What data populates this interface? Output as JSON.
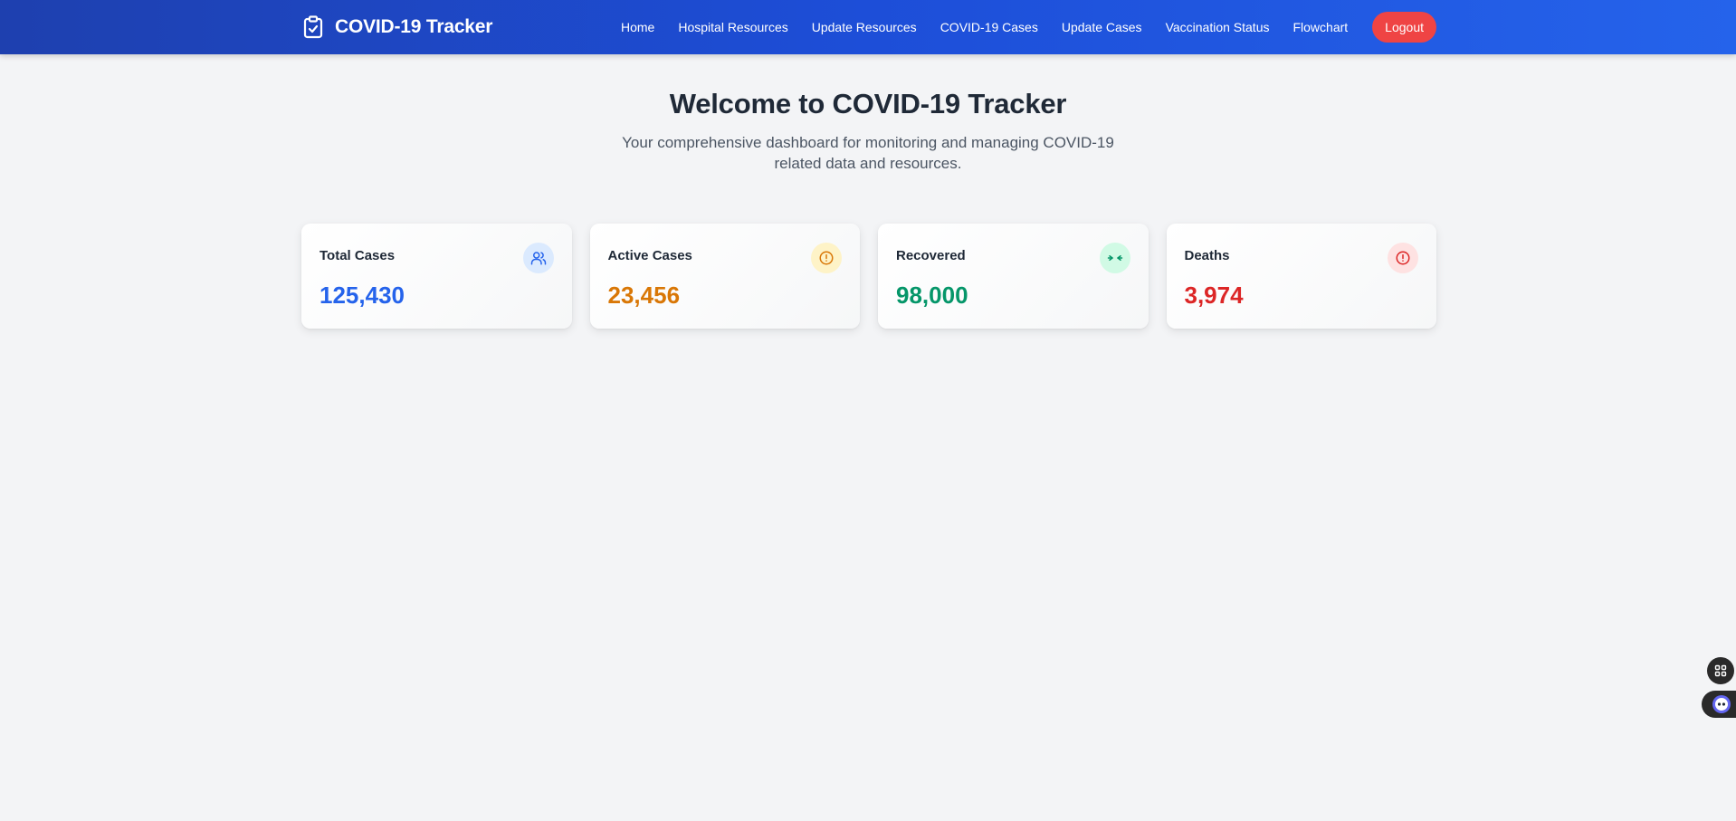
{
  "app": {
    "title": "COVID-19 Tracker",
    "brand_icon": "clipboard-check-icon"
  },
  "nav": {
    "links": [
      {
        "label": "Home"
      },
      {
        "label": "Hospital Resources"
      },
      {
        "label": "Update Resources"
      },
      {
        "label": "COVID-19 Cases"
      },
      {
        "label": "Update Cases"
      },
      {
        "label": "Vaccination Status"
      },
      {
        "label": "Flowchart"
      }
    ],
    "logout_label": "Logout"
  },
  "hero": {
    "title": "Welcome to COVID-19 Tracker",
    "subtitle": "Your comprehensive dashboard for monitoring and managing COVID-19 related data and resources."
  },
  "stats": [
    {
      "label": "Total Cases",
      "value": "125,430",
      "icon": "users-icon",
      "color": "#2563eb",
      "icon_bg": "#dbeafe"
    },
    {
      "label": "Active Cases",
      "value": "23,456",
      "icon": "alert-circle-icon",
      "color": "#d97706",
      "icon_bg": "#fef3c7"
    },
    {
      "label": "Recovered",
      "value": "98,000",
      "icon": "arrows-collapse-icon",
      "color": "#059669",
      "icon_bg": "#d1fae5"
    },
    {
      "label": "Deaths",
      "value": "3,974",
      "icon": "alert-circle-icon",
      "color": "#dc2626",
      "icon_bg": "#fee2e2"
    }
  ],
  "colors": {
    "nav_start": "#1e40af",
    "nav_end": "#2563eb",
    "logout": "#ef4444",
    "background": "#f3f4f6"
  },
  "floating": {
    "grid_icon": "grid-icon",
    "assistant_icon": "robot-icon"
  }
}
